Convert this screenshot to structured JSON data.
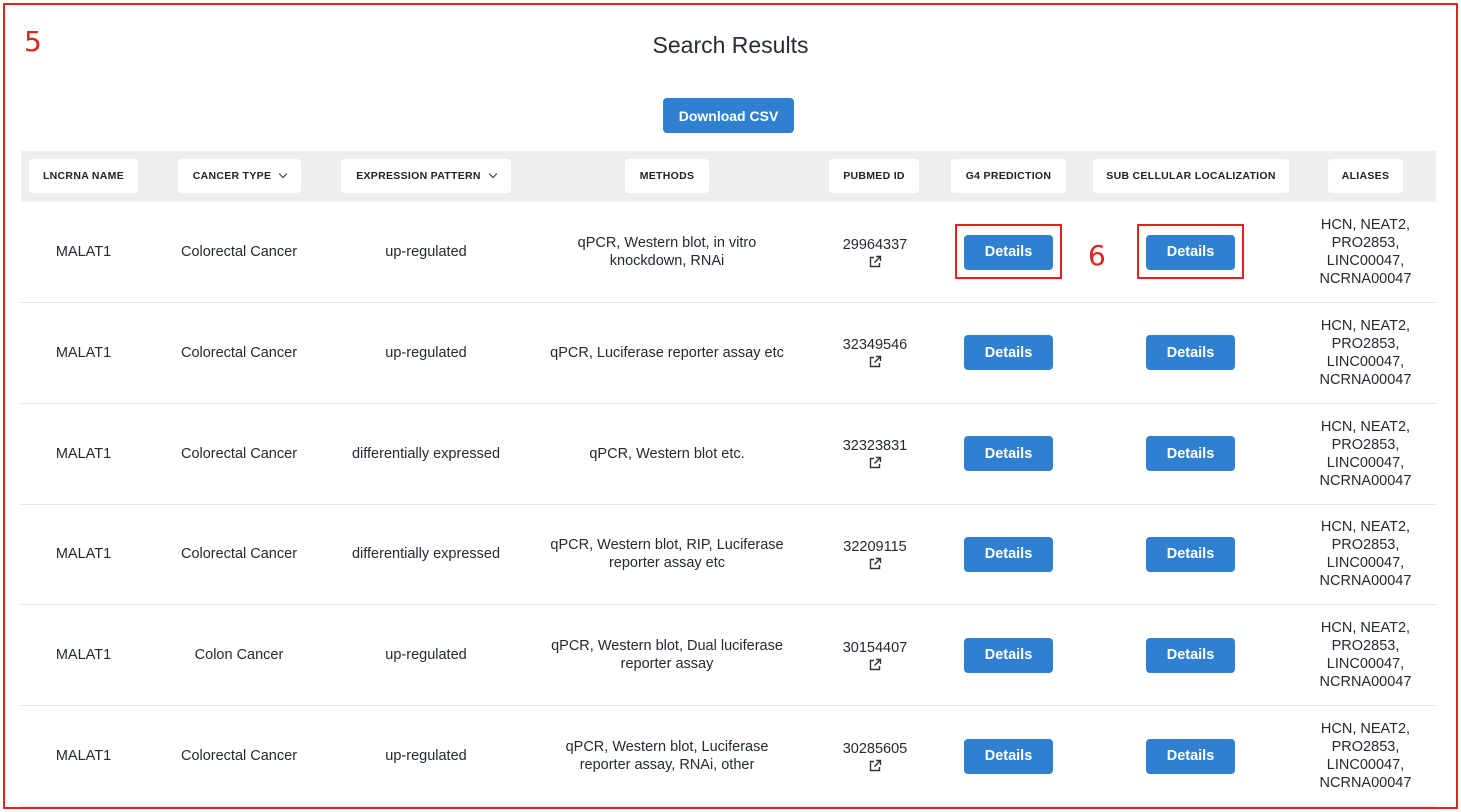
{
  "annotations": {
    "first": "5",
    "second": "6"
  },
  "page": {
    "title": "Search Results",
    "download_label": "Download CSV"
  },
  "columns": [
    {
      "label": "LNCRNA NAME",
      "sortable": false
    },
    {
      "label": "CANCER TYPE",
      "sortable": true
    },
    {
      "label": "EXPRESSION PATTERN",
      "sortable": true
    },
    {
      "label": "METHODS",
      "sortable": false
    },
    {
      "label": "PUBMED ID",
      "sortable": false
    },
    {
      "label": "G4 PREDICTION",
      "sortable": false
    },
    {
      "label": "SUB CELLULAR LOCALIZATION",
      "sortable": false
    },
    {
      "label": "ALIASES",
      "sortable": false
    }
  ],
  "rows": [
    {
      "name": "MALAT1",
      "cancer": "Colorectal Cancer",
      "expression": "up-regulated",
      "methods": "qPCR, Western blot, in vitro knockdown, RNAi",
      "pubmed": "29964337",
      "g4": "Details",
      "subcell": "Details",
      "aliases": "HCN, NEAT2, PRO2853, LINC00047, NCRNA00047"
    },
    {
      "name": "MALAT1",
      "cancer": "Colorectal Cancer",
      "expression": "up-regulated",
      "methods": "qPCR, Luciferase reporter assay etc",
      "pubmed": "32349546",
      "g4": "Details",
      "subcell": "Details",
      "aliases": "HCN, NEAT2, PRO2853, LINC00047, NCRNA00047"
    },
    {
      "name": "MALAT1",
      "cancer": "Colorectal Cancer",
      "expression": "differentially expressed",
      "methods": "qPCR, Western blot etc.",
      "pubmed": "32323831",
      "g4": "Details",
      "subcell": "Details",
      "aliases": "HCN, NEAT2, PRO2853, LINC00047, NCRNA00047"
    },
    {
      "name": "MALAT1",
      "cancer": "Colorectal Cancer",
      "expression": "differentially expressed",
      "methods": "qPCR, Western blot, RIP, Luciferase reporter assay etc",
      "pubmed": "32209115",
      "g4": "Details",
      "subcell": "Details",
      "aliases": "HCN, NEAT2, PRO2853, LINC00047, NCRNA00047"
    },
    {
      "name": "MALAT1",
      "cancer": "Colon Cancer",
      "expression": "up-regulated",
      "methods": "qPCR, Western blot, Dual luciferase reporter assay",
      "pubmed": "30154407",
      "g4": "Details",
      "subcell": "Details",
      "aliases": "HCN, NEAT2, PRO2853, LINC00047, NCRNA00047"
    },
    {
      "name": "MALAT1",
      "cancer": "Colorectal Cancer",
      "expression": "up-regulated",
      "methods": "qPCR, Western blot, Luciferase reporter assay, RNAi, other",
      "pubmed": "30285605",
      "g4": "Details",
      "subcell": "Details",
      "aliases": "HCN, NEAT2, PRO2853, LINC00047, NCRNA00047"
    }
  ],
  "colors": {
    "accent": "#2f80d0",
    "annotation": "#e0231f",
    "header_bg": "#eeeeee"
  },
  "icons": {
    "pubmed_link": "external-link-icon",
    "sort": "chevron-down-icon"
  }
}
